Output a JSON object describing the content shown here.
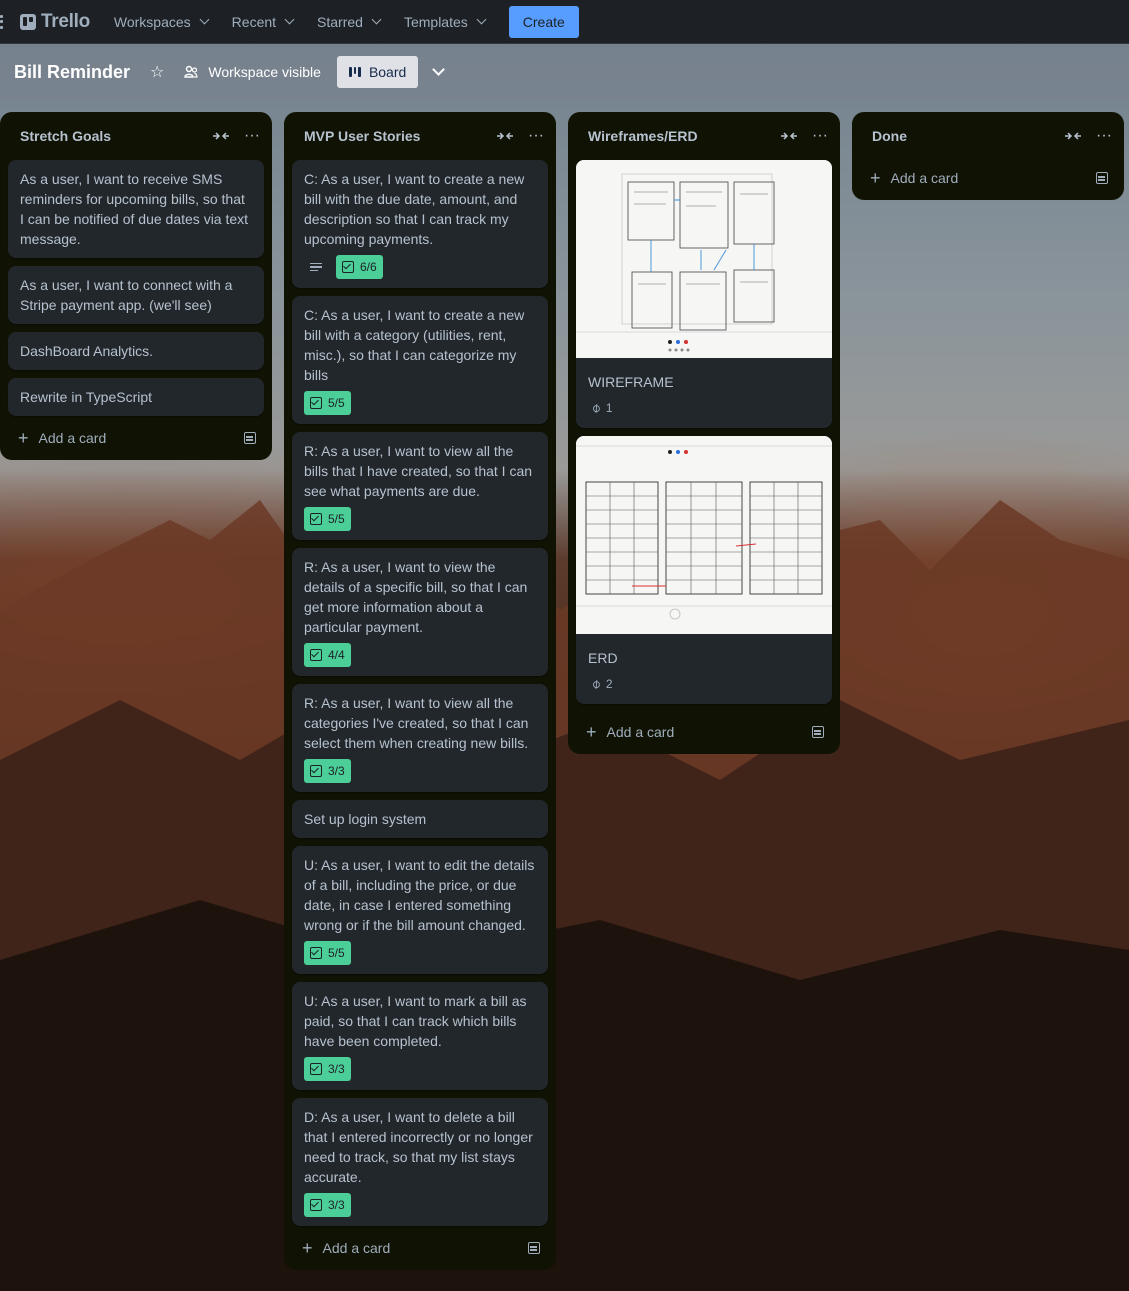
{
  "nav": {
    "logo": "Trello",
    "items": [
      "Workspaces",
      "Recent",
      "Starred",
      "Templates"
    ],
    "create_label": "Create"
  },
  "board": {
    "title": "Bill Reminder",
    "visibility": "Workspace visible",
    "view_label": "Board"
  },
  "lists": [
    {
      "title": "Stretch Goals",
      "add_label": "Add a card",
      "cards": [
        {
          "text": "As a user, I want to receive SMS reminders for upcoming bills, so that I can be notified of due dates via text message."
        },
        {
          "text": "As a user, I want to connect with a Stripe payment app. (we'll see)"
        },
        {
          "text": "DashBoard Analytics."
        },
        {
          "text": "Rewrite in TypeScript"
        }
      ]
    },
    {
      "title": "MVP User Stories",
      "add_label": "Add a card",
      "cards": [
        {
          "text": "C: As a user, I want to create a new bill with the due date, amount, and description so that I can track my upcoming payments.",
          "checklist": "6/6",
          "has_description": true
        },
        {
          "text": "C: As a user, I want to create a new bill with a category (utilities, rent, misc.), so that I can categorize my bills",
          "checklist": "5/5"
        },
        {
          "text": "R: As a user, I want to view all the bills that I have created, so that I can see what payments are due.",
          "checklist": "5/5"
        },
        {
          "text": "R: As a user, I want to view the details of a specific bill, so that I can get more information about a particular payment.",
          "checklist": "4/4"
        },
        {
          "text": "R: As a user, I want to view all the categories I've created, so that I can select them when creating new bills.",
          "checklist": "3/3"
        },
        {
          "text": "Set up login system"
        },
        {
          "text": "U: As a user, I want to edit the details of a bill, including the price, or due date, in case I entered something wrong or if the bill amount changed.",
          "checklist": "5/5"
        },
        {
          "text": "U: As a user, I want to mark a bill as paid, so that I can track which bills have been completed.",
          "checklist": "3/3"
        },
        {
          "text": "D: As a user, I want to delete a bill that I entered incorrectly or no longer need to track, so that my list stays accurate.",
          "checklist": "3/3"
        }
      ]
    },
    {
      "title": "Wireframes/ERD",
      "add_label": "Add a card",
      "cards": [
        {
          "text": "WIREFRAME",
          "attachments": "1"
        },
        {
          "text": "ERD",
          "attachments": "2"
        }
      ]
    },
    {
      "title": "Done",
      "add_label": "Add a card",
      "cards": []
    }
  ],
  "colors": {
    "nav_bg": "#1d2125",
    "list_bg": "#101204",
    "card_bg": "#22272b",
    "create_button": "#579dff",
    "checklist_complete": "#4bce97"
  },
  "icons": [
    "grip-icon",
    "trello-logo-icon",
    "chevron-down-icon",
    "star-icon",
    "workspace-visible-icon",
    "board-icon",
    "collapse-icon",
    "more-icon",
    "description-icon",
    "checklist-icon",
    "attachment-icon",
    "plus-icon",
    "template-icon"
  ]
}
